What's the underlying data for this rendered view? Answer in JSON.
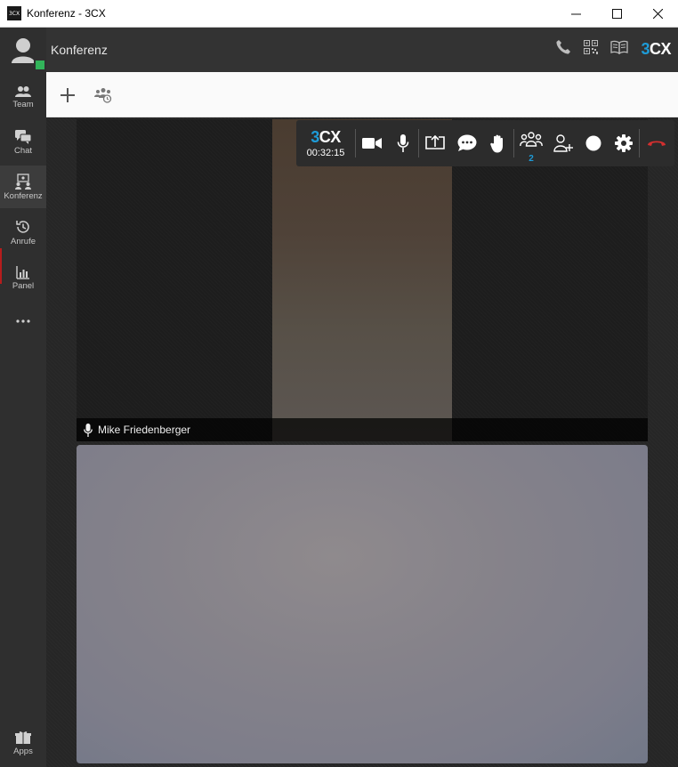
{
  "window": {
    "title": "Konferenz - 3CX",
    "app_icon_text": "3CX",
    "controls": [
      "minimize",
      "maximize",
      "close"
    ]
  },
  "sidebar": {
    "status_color": "#32b45a",
    "items": [
      {
        "label": "Team",
        "icon": "team-icon"
      },
      {
        "label": "Chat",
        "icon": "chat-icon"
      },
      {
        "label": "Konferenz",
        "icon": "conference-icon",
        "active": true
      },
      {
        "label": "Anrufe",
        "icon": "history-icon"
      },
      {
        "label": "Panel",
        "icon": "panel-icon"
      },
      {
        "label": "",
        "icon": "more-icon"
      }
    ],
    "apps_label": "Apps"
  },
  "header": {
    "title": "Konferenz",
    "logo_three": "3",
    "logo_cx": "CX",
    "icons": [
      "phone-icon",
      "qr-code-icon",
      "book-icon"
    ]
  },
  "toolbar": {
    "buttons": [
      "add-icon",
      "schedule-meeting-icon"
    ]
  },
  "call": {
    "logo_three": "3",
    "logo_cx": "CX",
    "duration": "00:32:15",
    "participants_count": "2",
    "controls": [
      "camera-icon",
      "microphone-icon",
      "screen-share-icon",
      "chat-icon",
      "raise-hand-icon",
      "participants-icon",
      "add-participant-icon",
      "record-icon",
      "settings-icon",
      "hangup-icon"
    ]
  },
  "participants": [
    {
      "name": "Mike Friedenberger",
      "mic": "on"
    }
  ],
  "colors": {
    "accent": "#1e9bd7",
    "hangup": "#d32f2f",
    "online": "#32b45a"
  }
}
